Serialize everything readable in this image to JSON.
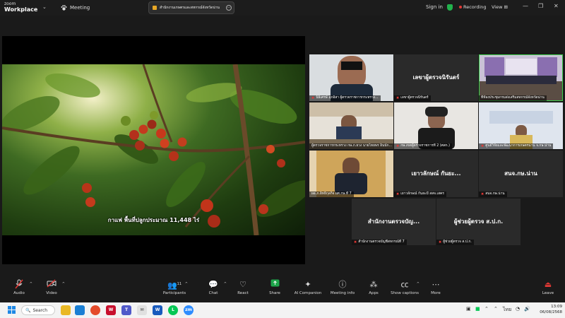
{
  "titlebar": {
    "logo_top": "zoom",
    "logo_bottom": "Workplace",
    "chevron": "⌄",
    "meeting_label": "Meeting",
    "tab_title": "สำนักงานเกษตรและสหกรณ์จังหวัดน่าน",
    "sign_in": "Sign in",
    "recording": "Recording",
    "view": "View"
  },
  "video": {
    "caption": "กาแฟ พื้นที่ปลูกประมาณ 11,448 ไร่"
  },
  "participants": [
    {
      "name": "นิธิเศรษ์ สุภอิสา ผู้ตรวจราชการกระทรวง..."
    },
    {
      "big": "เลขาผู้ตรวจนิรันดร์",
      "name": "เลขาผู้ตรวจนิรันดร์"
    },
    {
      "name": "ที่ห้องประชุมกรมส่งเสริมสหกรณ์จังหวัดน่าน"
    },
    {
      "name": "ผู้ตรวจราชการกระทรวง กษ.ภ.ยวง นายไทยพร อินนัก..."
    },
    {
      "name": "กษ.เขตผู้ตรวจราชการที่ 2 (ศสก.)"
    },
    {
      "name": "ศูนย์วิจัยและพัฒนาการเกษตรน่าน จ.กษ.น่าน"
    },
    {
      "name": "ผอ.ภ.อิทธิกุลกิจ ผศ.กษ.ที่ 7"
    },
    {
      "big": "เยาวลักษณ์ กันยะ...",
      "name": "เยาวลักษณ์ กันยะมี สสจ.เสคร"
    },
    {
      "big": "สนจ.กษ.น่าน",
      "name": "สนจ.กษ.น่าน"
    },
    {
      "big": "สำนักงานตรวจบัญ...",
      "name": "สำนักงานตรวจบัญชีสหกรณ์ที่ 7"
    },
    {
      "big": "ผู้ช่วยผู้ตรวจ ส.ป.ก.",
      "name": "ผู้ช่วยผู้ตรวจ ส.ป.ก."
    }
  ],
  "toolbar": {
    "audio": "Audio",
    "video": "Video",
    "participants": "Participants",
    "participants_count": "11",
    "chat": "Chat",
    "react": "React",
    "share": "Share",
    "ai_companion": "AI Companion",
    "meeting_info": "Meeting info",
    "apps": "Apps",
    "show_captions": "Show captions",
    "more": "More",
    "leave": "Leave"
  },
  "taskbar": {
    "search": "Search",
    "lang": "ไทย",
    "time": "13:09",
    "date": "06/08/2568"
  },
  "colors": {
    "accent_green": "#3fcf4d",
    "muted_red": "#e53935",
    "share_green": "#1ea64b"
  }
}
